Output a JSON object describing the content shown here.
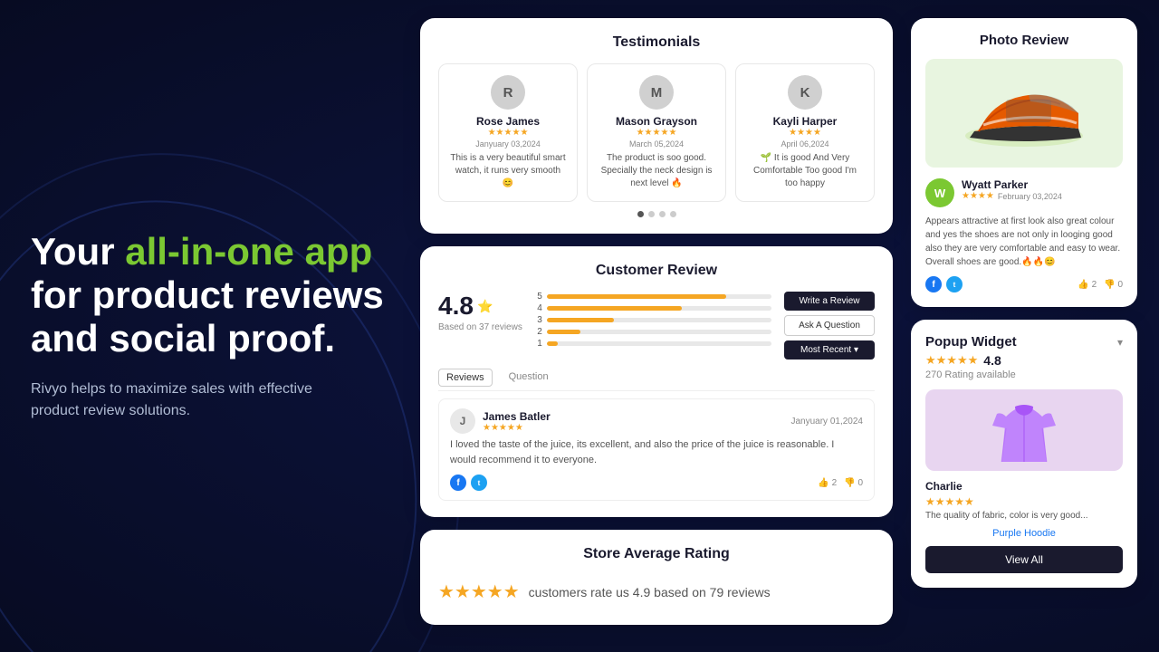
{
  "hero": {
    "title_part1": "Your ",
    "title_accent": "all-in-one app",
    "title_part2": " for product reviews and social proof.",
    "subtitle": "Rivyo helps to maximize sales with effective product review solutions."
  },
  "testimonials": {
    "card_title": "Testimonials",
    "items": [
      {
        "initial": "R",
        "name": "Rose James",
        "date": "Janyuary 03,2024",
        "stars": 5,
        "text": "This is a very beautiful smart watch, it runs very smooth😊"
      },
      {
        "initial": "M",
        "name": "Mason Grayson",
        "date": "March 05,2024",
        "stars": 5,
        "text": "The product is soo good. Specially the neck design is next level 🔥"
      },
      {
        "initial": "K",
        "name": "Kayli Harper",
        "date": "April 06,2024",
        "stars": 4,
        "text": "🌱 It is good And Very Comfortable Too good I'm too happy"
      }
    ],
    "dots": [
      true,
      false,
      false,
      false
    ]
  },
  "customer_review": {
    "card_title": "Customer Review",
    "rating": "4.8",
    "rating_star": "⭐",
    "based_on": "Based on 37 reviews",
    "bars": [
      {
        "label": "5",
        "pct": 80
      },
      {
        "label": "4",
        "pct": 60
      },
      {
        "label": "3",
        "pct": 30
      },
      {
        "label": "2",
        "pct": 15
      },
      {
        "label": "1",
        "pct": 5
      }
    ],
    "btn_write": "Write a Review",
    "btn_ask": "Ask A Question",
    "btn_recent": "Most Recent ▾",
    "tab_reviews": "Reviews",
    "tab_question": "Question",
    "review": {
      "initial": "J",
      "name": "James Batler",
      "date": "Janyuary 01,2024",
      "stars": 5,
      "text": "I loved the taste of the juice, its excellent, and also the price of the juice is reasonable. I would recommend it to everyone.",
      "thumbs_up": "2",
      "thumbs_down": "0"
    }
  },
  "store_rating": {
    "card_title": "Store Average Rating",
    "stars": 5,
    "text": "customers rate us 4.9 based on 79 reviews"
  },
  "photo_review": {
    "card_title": "Photo Review",
    "reviewer": {
      "initial": "W",
      "name": "Wyatt Parker",
      "date": "February 03,2024",
      "stars": 4,
      "text": "Appears attractive at first look also great colour and yes the shoes are not only in looging good also they are very comfortable and easy to wear. Overall shoes are good.🔥🔥😊"
    },
    "thumbs_up": "2",
    "thumbs_down": "0"
  },
  "popup_widget": {
    "card_title": "Popup Widget",
    "rating": "4.8",
    "stars": 5,
    "rating_count": "270 Rating available",
    "product": {
      "name": "Charlie",
      "stars": 5,
      "desc": "The quality of fabric, color is very good...",
      "link": "Purple Hoodie"
    },
    "btn_view_all": "View All"
  }
}
